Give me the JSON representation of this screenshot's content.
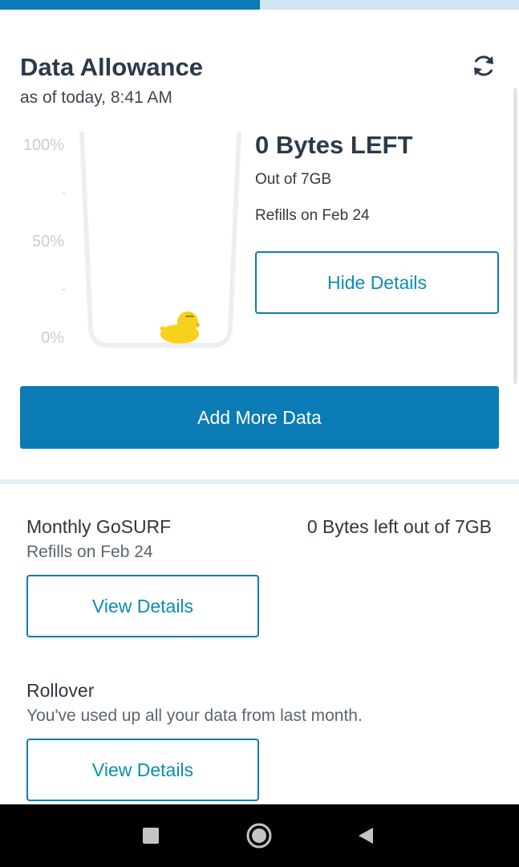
{
  "progress": {
    "fraction": 0.5
  },
  "header": {
    "title": "Data Allowance",
    "subtitle": "as of today, 8:41 AM",
    "refresh_icon": "refresh-icon"
  },
  "gauge": {
    "labels": [
      "100%",
      "-",
      "50%",
      "-",
      "0%"
    ],
    "fill_percent": 0,
    "mascot_icon": "duck-icon"
  },
  "summary": {
    "left_text": "0 Bytes LEFT",
    "out_of": "Out of 7GB",
    "refills": "Refills on Feb 24",
    "toggle_label": "Hide Details"
  },
  "add_data_label": "Add More Data",
  "plans": [
    {
      "name": "Monthly GoSURF",
      "sub": "Refills on Feb 24",
      "right": "0 Bytes left out of 7GB",
      "button": "View Details"
    },
    {
      "name": "Rollover",
      "sub": "You've used up all your data from last month.",
      "button": "View Details"
    }
  ],
  "navbar": {
    "items": [
      "recents-square-icon",
      "home-circle-icon",
      "back-triangle-icon"
    ]
  },
  "colors": {
    "accent": "#0a7bb5",
    "accent_text": "#0a8db3",
    "progress_track": "#cfe6f2",
    "duck": "#f7d21c"
  }
}
